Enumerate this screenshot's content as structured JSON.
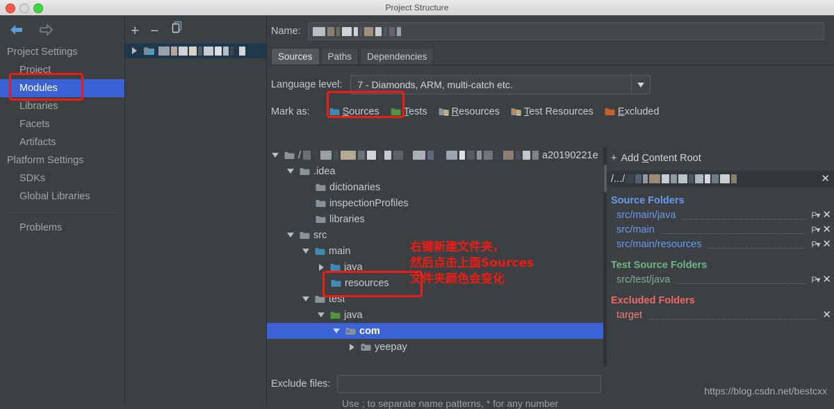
{
  "window": {
    "title": "Project Structure",
    "controls": [
      "close-red",
      "minimize-gray",
      "maximize-green"
    ]
  },
  "sidebar": {
    "back_icon": "arrow-left-icon",
    "forward_icon": "arrow-right-icon",
    "groups": [
      {
        "label": "Project Settings",
        "items": [
          {
            "label": "Project",
            "selected": false
          },
          {
            "label": "Modules",
            "selected": true,
            "highlighted": true
          },
          {
            "label": "Libraries",
            "selected": false
          },
          {
            "label": "Facets",
            "selected": false
          },
          {
            "label": "Artifacts",
            "selected": false
          }
        ]
      },
      {
        "label": "Platform Settings",
        "items": [
          {
            "label": "SDKs",
            "selected": false
          },
          {
            "label": "Global Libraries",
            "selected": false
          }
        ]
      }
    ],
    "problems_label": "Problems"
  },
  "module_list": {
    "toolbar": [
      {
        "name": "add-module-button",
        "glyph": "+"
      },
      {
        "name": "remove-module-button",
        "glyph": "−"
      },
      {
        "name": "copy-module-button",
        "glyph": "copy-icon"
      }
    ],
    "rows": [
      {
        "name": "module-row-redacted",
        "label": "",
        "redacted": true,
        "selected": true
      }
    ]
  },
  "editor": {
    "name_label": "Name:",
    "name_value": "",
    "name_redacted": true,
    "tabs": [
      {
        "label": "Sources",
        "active": true
      },
      {
        "label": "Paths",
        "active": false
      },
      {
        "label": "Dependencies",
        "active": false
      }
    ],
    "language_level_label": "Language level:",
    "language_level_value": "7 - Diamonds, ARM, multi-catch etc.",
    "mark_as_label": "Mark as:",
    "mark_as": [
      {
        "label": "Sources",
        "mnemonic": "S",
        "color": "#3d8ab5",
        "boxed": true
      },
      {
        "label": "Tests",
        "mnemonic": "T",
        "color": "#51953f",
        "boxed": false
      },
      {
        "label": "Resources",
        "mnemonic": "R",
        "color": "#8a9299",
        "boxed": false
      },
      {
        "label": "Test Resources",
        "mnemonic": "T",
        "color": "#8a9299",
        "boxed": false
      },
      {
        "label": "Excluded",
        "mnemonic": "E",
        "color": "#c2622c",
        "boxed": false
      }
    ],
    "exclude_files_label": "Exclude files:",
    "exclude_files_value": "",
    "exclude_hint": "Use ; to separate name patterns, * for any number"
  },
  "tree": {
    "rows": [
      {
        "label": "a20190221e",
        "indent": 0,
        "twisty": "down",
        "folder_color": "#8a9299",
        "redacted_prefix": true,
        "selected": false
      },
      {
        "label": ".idea",
        "indent": 1,
        "twisty": "down",
        "folder_color": "#8a9299",
        "selected": false
      },
      {
        "label": "dictionaries",
        "indent": 2,
        "twisty": "none",
        "folder_color": "#8a9299",
        "selected": false
      },
      {
        "label": "inspectionProfiles",
        "indent": 2,
        "twisty": "none",
        "folder_color": "#8a9299",
        "selected": false
      },
      {
        "label": "libraries",
        "indent": 2,
        "twisty": "none",
        "folder_color": "#8a9299",
        "selected": false
      },
      {
        "label": "src",
        "indent": 1,
        "twisty": "down",
        "folder_color": "#8a9299",
        "selected": false
      },
      {
        "label": "main",
        "indent": 2,
        "twisty": "down",
        "folder_color": "#3d8ab5",
        "selected": false
      },
      {
        "label": "java",
        "indent": 3,
        "twisty": "right",
        "folder_color": "#3d8ab5",
        "selected": false
      },
      {
        "label": "resources",
        "indent": 3,
        "twisty": "none",
        "folder_color": "#3d8ab5",
        "selected": false,
        "boxed": true
      },
      {
        "label": "test",
        "indent": 2,
        "twisty": "down",
        "folder_color": "#8a9299",
        "selected": false
      },
      {
        "label": "java",
        "indent": 3,
        "twisty": "down",
        "folder_color": "#51953f",
        "selected": false
      },
      {
        "label": "com",
        "indent": 4,
        "twisty": "down",
        "folder_color": "#8a9299",
        "selected": true
      },
      {
        "label": "yeepay",
        "indent": 5,
        "twisty": "right",
        "folder_color": "#8a9299",
        "selected": false
      }
    ]
  },
  "folders_panel": {
    "add_content_root_label": "Add Content Root",
    "add_content_root_mnemonic": "C",
    "content_root_prefix": "/.../",
    "content_root_value": "",
    "content_root_redacted": true,
    "remove_root_icon": "close-icon",
    "sections": [
      {
        "title": "Source Folders",
        "kind": "src",
        "items": [
          {
            "label": "src/main/java",
            "has_package_prefix_button": true,
            "has_remove": true
          },
          {
            "label": "src/main",
            "has_package_prefix_button": true,
            "has_remove": true
          },
          {
            "label": "src/main/resources",
            "has_package_prefix_button": true,
            "has_remove": true
          }
        ]
      },
      {
        "title": "Test Source Folders",
        "kind": "test",
        "items": [
          {
            "label": "src/test/java",
            "has_package_prefix_button": true,
            "has_remove": true
          }
        ]
      },
      {
        "title": "Excluded Folders",
        "kind": "exc",
        "items": [
          {
            "label": "target",
            "has_package_prefix_button": false,
            "has_remove": true
          }
        ]
      }
    ]
  },
  "annotations": {
    "note_lines": [
      "右键新建文件夹，",
      "然后点击上面Sources",
      "文件夹颜色会变化"
    ],
    "note_color": "#ee1c12",
    "highlight_color": "#ee1c12"
  },
  "watermark": "https://blog.csdn.net/bestcxx",
  "colors": {
    "background": "#3c4043",
    "selection_blue": "#3b63d6",
    "source_blue": "#6b9bf0",
    "test_green": "#6fb584",
    "excluded_red": "#f06868",
    "annotation_red": "#ee1c12"
  }
}
